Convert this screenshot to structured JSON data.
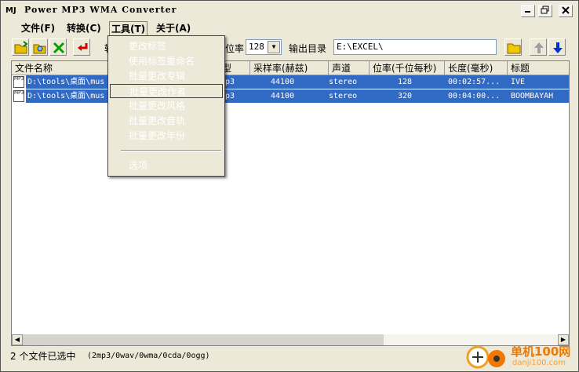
{
  "window": {
    "title": "Power MP3 WMA Converter",
    "icon_text": "MJ"
  },
  "menubar": {
    "items": [
      {
        "label": "文件(F)"
      },
      {
        "label": "转换(C)"
      },
      {
        "label": "工具(T)"
      },
      {
        "label": "关于(A)"
      }
    ]
  },
  "toolbar": {
    "bitrate_label": "位率",
    "bitrate_value": "128",
    "output_label": "输出目录",
    "output_path": "E:\\EXCEL\\"
  },
  "tools_menu": {
    "items": [
      {
        "label": "更改标签"
      },
      {
        "label": "使用标签重命名"
      },
      {
        "label": "批量更改专辑"
      },
      {
        "label": "批量更改作者"
      },
      {
        "label": "批量更改风格"
      },
      {
        "label": "批量更改音轨"
      },
      {
        "label": "批量更改年份"
      },
      {
        "label": "选项"
      }
    ],
    "highlighted_index": 3
  },
  "list": {
    "columns": [
      {
        "label": "文件名称"
      },
      {
        "label": "类型"
      },
      {
        "label": "采样率(赫兹)"
      },
      {
        "label": "声道"
      },
      {
        "label": "位率(千位每秒)"
      },
      {
        "label": "长度(毫秒)"
      },
      {
        "label": "标题"
      }
    ],
    "type_fragment": "型",
    "rows": [
      {
        "filename": "D:\\tools\\桌面\\mus",
        "type": "p3",
        "sample": "44100",
        "channel": "stereo",
        "bitrate": "128",
        "length": "00:02:57...",
        "title": "IVE"
      },
      {
        "filename": "D:\\tools\\桌面\\mus",
        "type": "p3",
        "sample": "44100",
        "channel": "stereo",
        "bitrate": "320",
        "length": "00:04:00...",
        "title": "BOOMBAYAH"
      }
    ]
  },
  "status": {
    "selected_text": "2 个文件已选中",
    "formats": "(2mp3/0wav/0wma/0cda/0ogg)"
  },
  "watermark": {
    "name": "单机100网",
    "url": "danji100.com"
  },
  "colors": {
    "selection": "#316ac5",
    "face": "#ece9d8"
  }
}
